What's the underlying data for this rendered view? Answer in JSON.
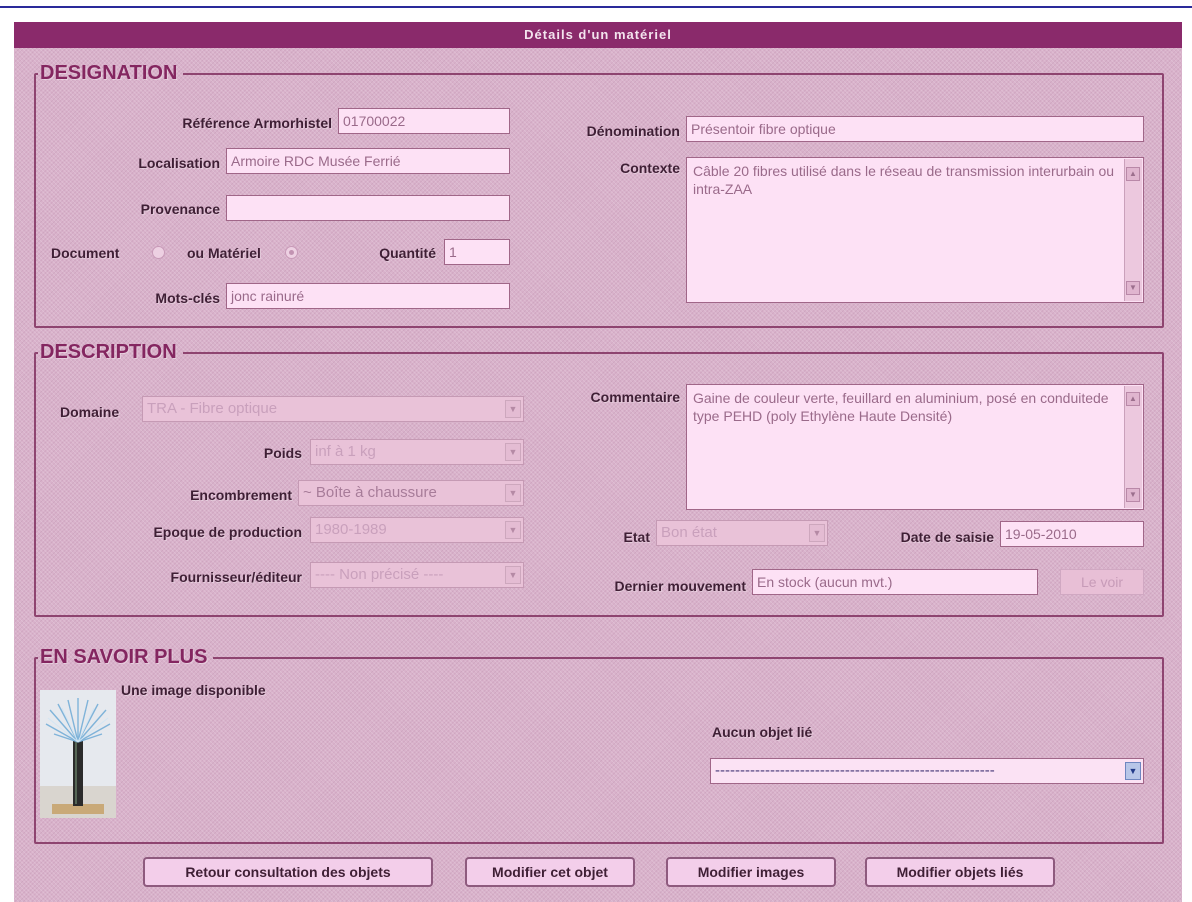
{
  "window": {
    "title": "Détails d'un matériel"
  },
  "designation": {
    "legend": "DESIGNATION",
    "reference_label": "Référence Armorhistel",
    "reference_value": "01700022",
    "localisation_label": "Localisation",
    "localisation_value": "Armoire RDC Musée Ferrié",
    "provenance_label": "Provenance",
    "provenance_value": "",
    "document_label": "Document",
    "materiel_label": "ou Matériel",
    "quantite_label": "Quantité",
    "quantite_value": "1",
    "mots_cles_label": "Mots-clés",
    "mots_cles_value": "jonc rainuré",
    "denomination_label": "Dénomination",
    "denomination_value": "Présentoir fibre optique",
    "contexte_label": "Contexte",
    "contexte_value": "Câble 20 fibres utilisé dans le réseau de transmission interurbain ou intra-ZAA"
  },
  "description": {
    "legend": "DESCRIPTION",
    "domaine_label": "Domaine",
    "domaine_value": "TRA - Fibre optique",
    "poids_label": "Poids",
    "poids_value": "inf à 1 kg",
    "encombrement_label": "Encombrement",
    "encombrement_value": "~ Boîte à chaussure",
    "epoque_label": "Epoque de production",
    "epoque_value": "1980-1989",
    "fournisseur_label": "Fournisseur/éditeur",
    "fournisseur_value": "---- Non précisé ----",
    "commentaire_label": "Commentaire",
    "commentaire_value": "Gaine de couleur verte, feuillard en aluminium, posé en conduitede type PEHD (poly Ethylène Haute Densité)",
    "etat_label": "Etat",
    "etat_value": "Bon état",
    "date_saisie_label": "Date de saisie",
    "date_saisie_value": "19-05-2010",
    "dernier_mouvement_label": "Dernier mouvement",
    "dernier_mouvement_value": "En stock (aucun mvt.)",
    "le_voir_label": "Le voir"
  },
  "en_savoir_plus": {
    "legend": "EN SAVOIR PLUS",
    "image_label": "Une image disponible",
    "objets_lies_label": "Aucun objet lié",
    "objets_lies_value": "--------------------------------------------------------"
  },
  "buttons": {
    "retour": "Retour consultation des objets",
    "modifier_objet": "Modifier cet objet",
    "modifier_images": "Modifier images",
    "modifier_objets_lies": "Modifier objets liés"
  }
}
